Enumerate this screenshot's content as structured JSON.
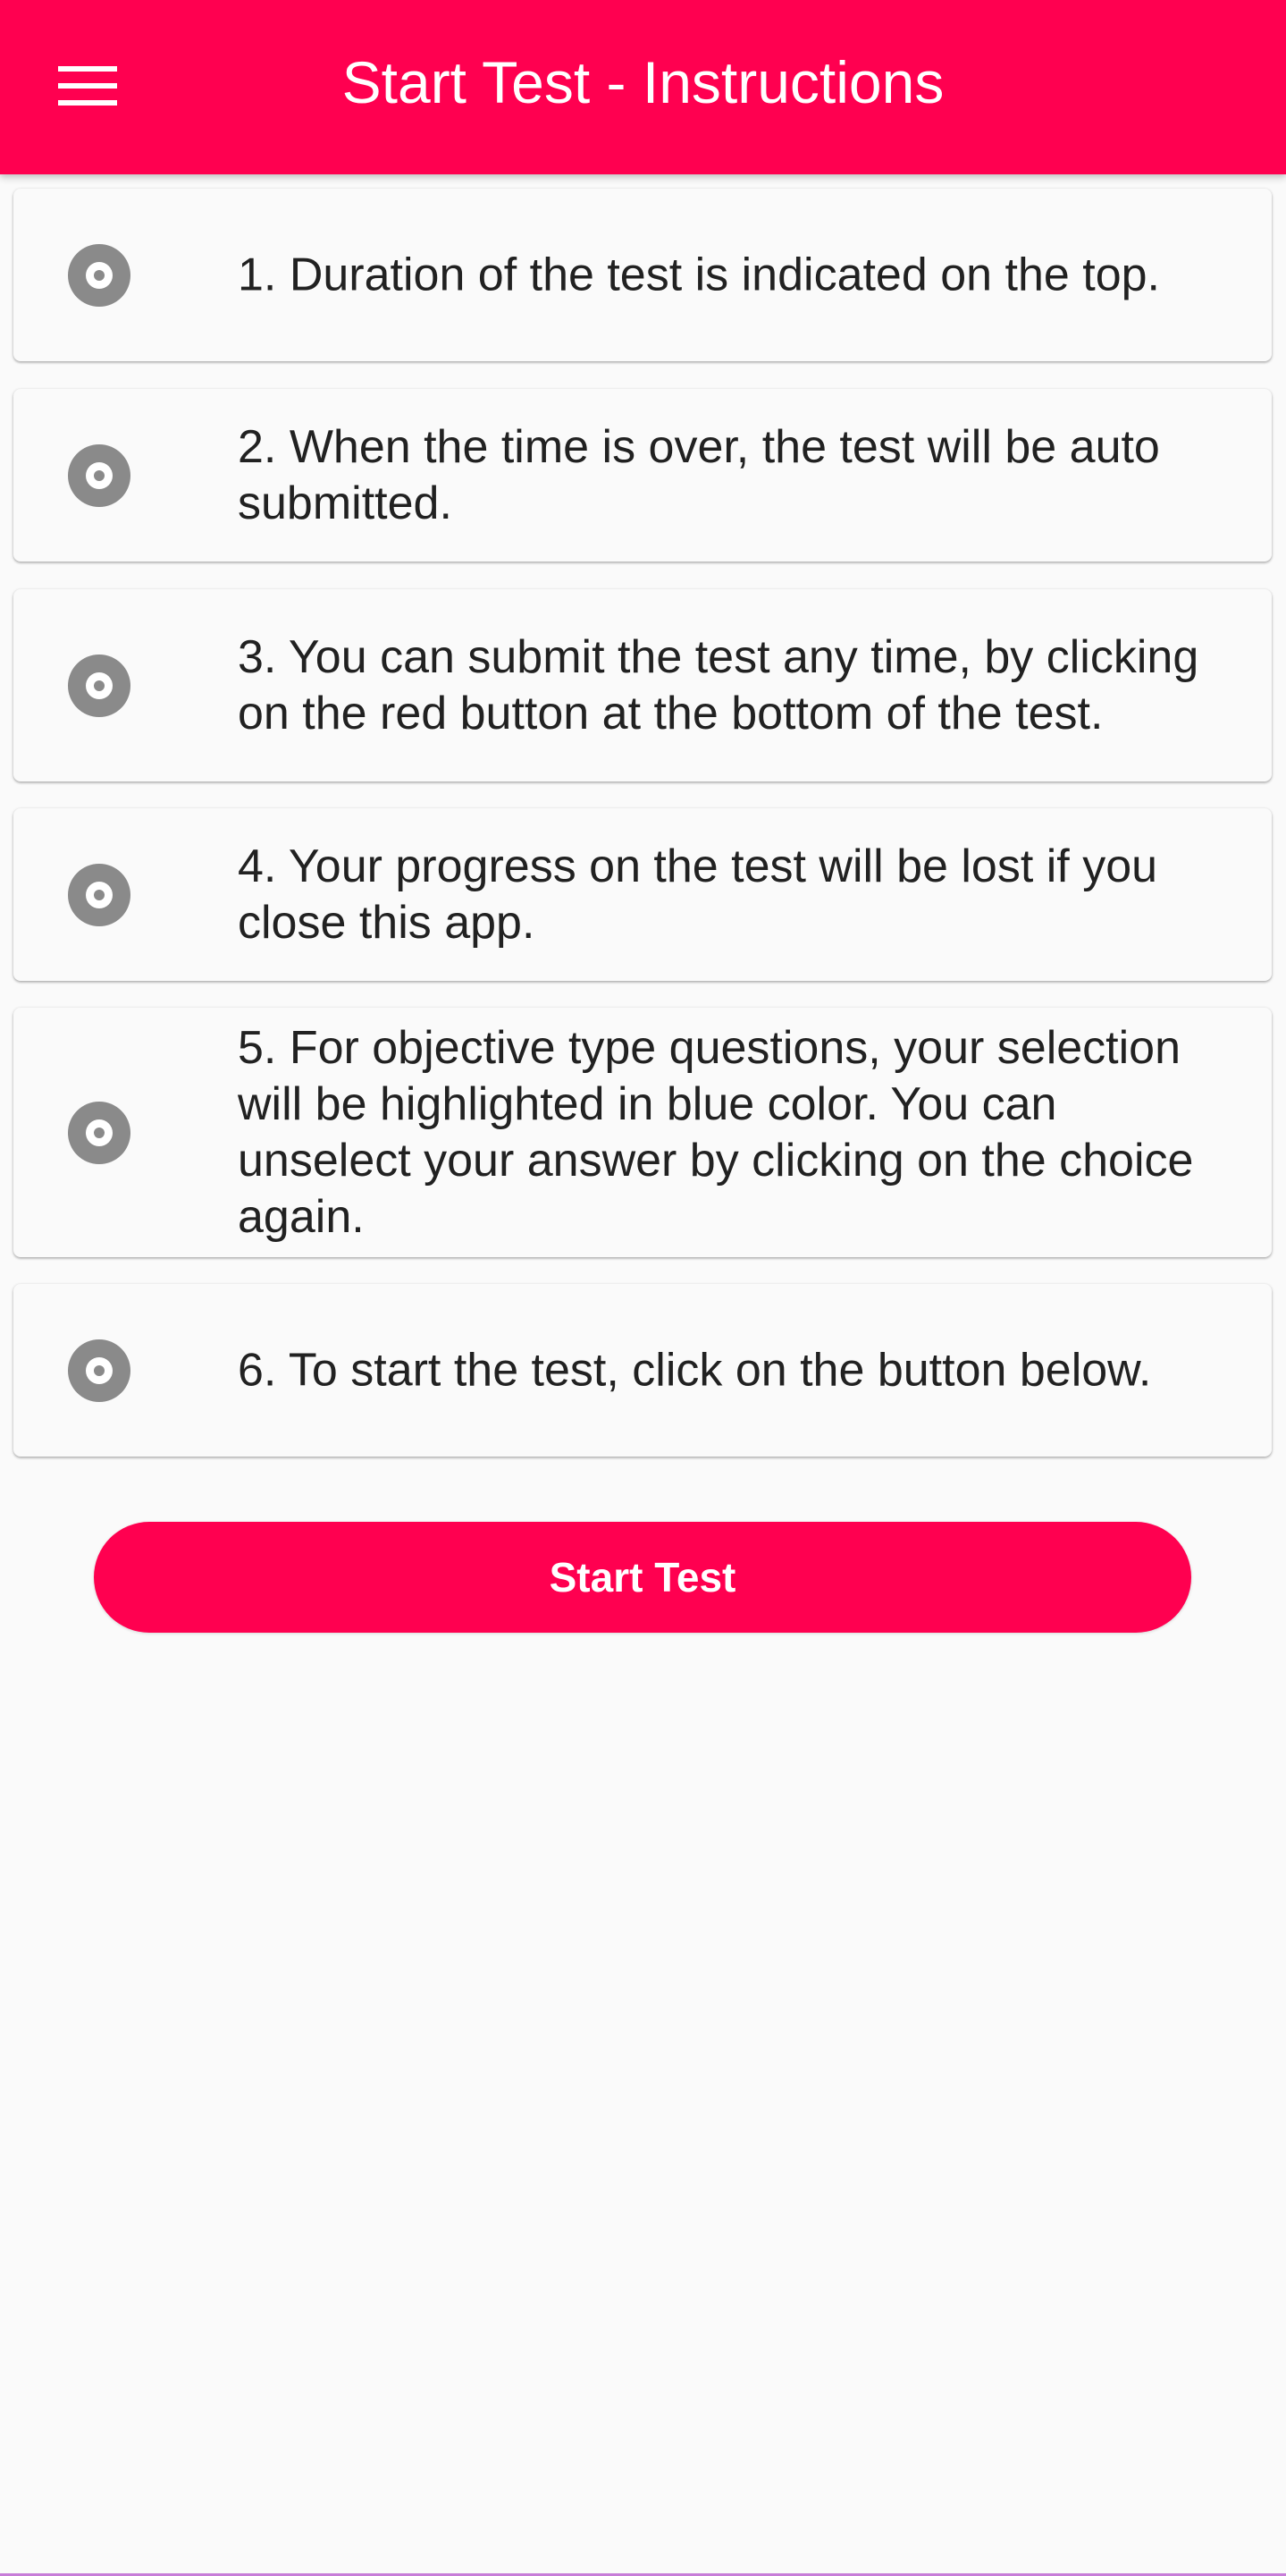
{
  "toolbar": {
    "title": "Start Test - Instructions",
    "menu_icon": "hamburger-menu-icon",
    "background_color": "#ff0050"
  },
  "instructions": [
    {
      "icon": "radio-circle-icon",
      "text": "1. Duration of the test is indicated on the top."
    },
    {
      "icon": "radio-circle-icon",
      "text": "2. When the time is over, the test will be auto submitted."
    },
    {
      "icon": "radio-circle-icon",
      "text": "3. You can submit the test any time, by clicking on the red button at the bottom of the test."
    },
    {
      "icon": "radio-circle-icon",
      "text": "4. Your progress on the test will be lost if you close this app."
    },
    {
      "icon": "radio-circle-icon",
      "text": "5. For objective type questions, your selection will be highlighted in blue color. You can unselect your answer by clicking on the choice again."
    },
    {
      "icon": "radio-circle-icon",
      "text": "6. To start the test, click on the button below."
    }
  ],
  "start_button": {
    "label": "Start Test",
    "color": "#ff0050"
  },
  "colors": {
    "accent": "#ff0050",
    "icon_gray": "#8a8a8a",
    "text": "#212121",
    "background": "#fafafa"
  }
}
